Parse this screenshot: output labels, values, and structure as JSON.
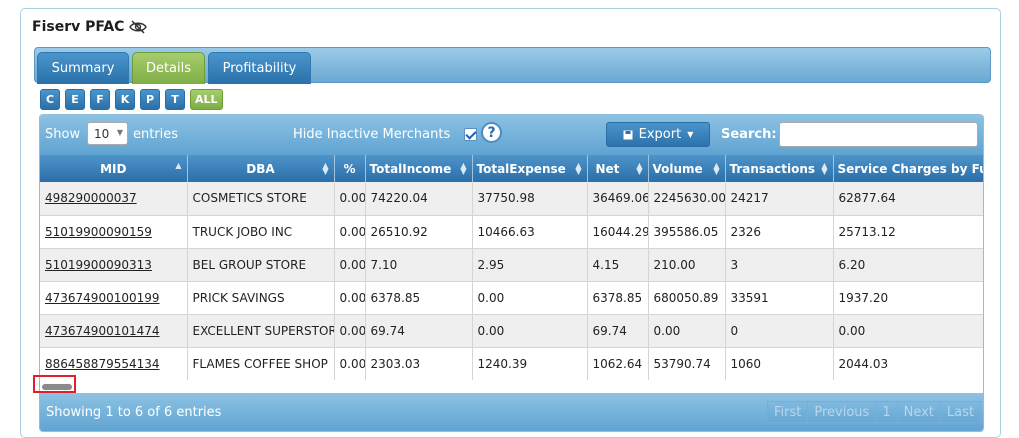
{
  "panel": {
    "title": "Fiserv PFAC"
  },
  "tabs": [
    {
      "label": "Summary",
      "active": false
    },
    {
      "label": "Details",
      "active": true
    },
    {
      "label": "Profitability",
      "active": false
    }
  ],
  "filters": [
    "C",
    "E",
    "F",
    "K",
    "P",
    "T",
    "ALL"
  ],
  "toolbar": {
    "show_label": "Show",
    "page_size": "10",
    "entries_label": "entries",
    "hide_inactive_label": "Hide Inactive Merchants",
    "help_glyph": "?",
    "export_label": "Export",
    "search_label": "Search:",
    "search_value": ""
  },
  "table": {
    "columns": [
      "MID",
      "DBA",
      "%",
      "TotalIncome",
      "TotalExpense",
      "Net",
      "Volume",
      "Transactions",
      "Service Charges by Fund"
    ],
    "rows": [
      [
        "498290000037",
        "COSMETICS STORE",
        "0.00",
        "74220.04",
        "37750.98",
        "36469.06",
        "2245630.00",
        "24217",
        "62877.64"
      ],
      [
        "51019900090159",
        "TRUCK JOBO INC",
        "0.00",
        "26510.92",
        "10466.63",
        "16044.29",
        "395586.05",
        "2326",
        "25713.12"
      ],
      [
        "51019900090313",
        "BEL GROUP STORE",
        "0.00",
        "7.10",
        "2.95",
        "4.15",
        "210.00",
        "3",
        "6.20"
      ],
      [
        "473674900100199",
        "PRICK SAVINGS",
        "0.00",
        "6378.85",
        "0.00",
        "6378.85",
        "680050.89",
        "33591",
        "1937.20"
      ],
      [
        "473674900101474",
        "EXCELLENT SUPERSTORE",
        "0.00",
        "69.74",
        "0.00",
        "69.74",
        "0.00",
        "0",
        "0.00"
      ],
      [
        "886458879554134",
        "FLAMES COFFEE SHOP",
        "0.00",
        "2303.03",
        "1240.39",
        "1062.64",
        "53790.74",
        "1060",
        "2044.03"
      ]
    ]
  },
  "footer": {
    "info": "Showing 1 to 6 of 6 entries",
    "pager": [
      "First",
      "Previous",
      "1",
      "Next",
      "Last"
    ]
  },
  "colors": {
    "accent_blue": "#2b6ea9",
    "active_green": "#7fae45",
    "highlight_red": "#e0202a"
  }
}
